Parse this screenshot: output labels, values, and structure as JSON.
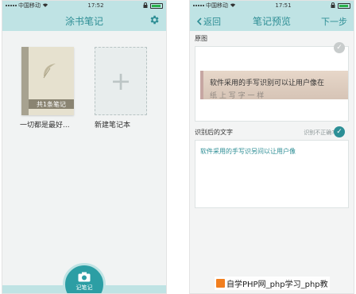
{
  "status_left": {
    "carrier": "中国移动",
    "time": "17:52"
  },
  "status_right": {
    "carrier": "中国移动",
    "time": "17:51"
  },
  "left_screen": {
    "title": "涂书笔记",
    "book": {
      "count_label": "共1条笔记",
      "caption": "一切都是最好..."
    },
    "new_book": {
      "plus": "+",
      "caption": "新建笔记本"
    },
    "camera_label": "记笔记"
  },
  "right_screen": {
    "back_label": "返回",
    "title": "笔记预览",
    "next_label": "下一步",
    "original_label": "原图",
    "photo_line1": "软件采用的手写识别可以让用户像在",
    "photo_line2": "纸 上 写 字 一 样",
    "result_label": "识别后的文字",
    "wrong_label": "识别不正确?",
    "result_text": "软件采用的手写识另间以让用户像"
  },
  "watermark": {
    "text": "自学PHP网_php学习_php教"
  },
  "icons": {
    "gear": "gear-icon",
    "camera": "camera-icon",
    "back": "chevron-left-icon",
    "check": "check-icon",
    "leaf": "feather-icon",
    "wifi": "wifi-icon",
    "lock": "lock-icon"
  },
  "colors": {
    "accent": "#2e8e95",
    "header_bg": "#bfe3e4",
    "camera_bg": "#2c9ea4"
  }
}
